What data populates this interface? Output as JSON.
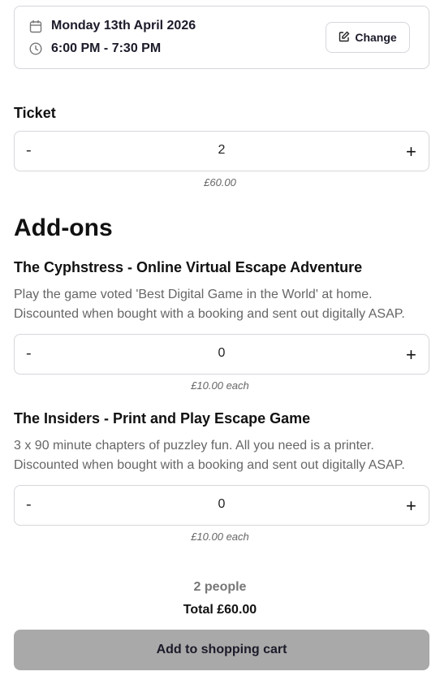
{
  "booking": {
    "date": "Monday 13th April 2026",
    "time": "6:00 PM - 7:30 PM",
    "change_label": "Change",
    "date_icon": "calendar-icon",
    "time_icon": "clock-icon",
    "change_icon": "edit-icon"
  },
  "ticket": {
    "label": "Ticket",
    "minus": "-",
    "plus": "+",
    "quantity": "2",
    "price": "£60.00"
  },
  "addons": {
    "title": "Add-ons",
    "items": [
      {
        "name": "The Cyphstress - Online Virtual Escape Adventure",
        "description": "Play the game voted 'Best Digital Game in the World' at home. Discounted when bought with a booking and sent out digitally ASAP.",
        "minus": "-",
        "plus": "+",
        "quantity": "0",
        "price": "£10.00 each"
      },
      {
        "name": "The Insiders - Print and Play Escape Game",
        "description": "3 x 90 minute chapters of puzzley fun. All you need is a printer. Discounted when bought with a booking and sent out digitally ASAP.",
        "minus": "-",
        "plus": "+",
        "quantity": "0",
        "price": "£10.00 each"
      }
    ]
  },
  "summary": {
    "people": "2 people",
    "total": "Total £60.00",
    "cart_button": "Add to shopping cart"
  },
  "colors": {
    "cart_button_bg": "#a9a9a9",
    "border": "#d6d6dc",
    "muted_text": "#666666"
  }
}
